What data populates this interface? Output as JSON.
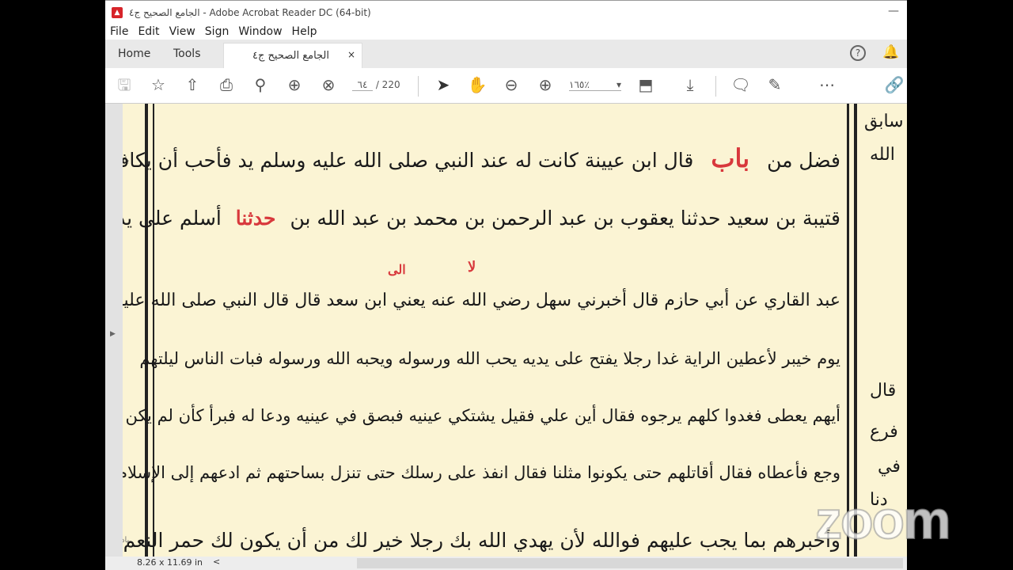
{
  "window": {
    "title": "الجامع الصحيح ج٤ - Adobe Acrobat Reader DC (64-bit)",
    "minimize": "—"
  },
  "menu": [
    "File",
    "Edit",
    "View",
    "Sign",
    "Window",
    "Help"
  ],
  "tabs": {
    "home": "Home",
    "tools": "Tools",
    "document": "الجامع الصحيح ج٤",
    "close": "×",
    "help": "?"
  },
  "toolbar": {
    "page_current": "٦٤",
    "page_total": "/ 220",
    "zoom": "١٦٥٪"
  },
  "status": {
    "page_size": "8.26 x 11.69 in",
    "scroll_left": "<"
  },
  "page": {
    "lines": [
      "قال ابن عيينة كانت له عند النبي صلى الله عليه وسلم يد فأحب أن يكافئه",
      "قتيبة بن سعيد حدثنا يعقوب بن عبد الرحمن بن محمد بن عبد الله بن",
      "عبد القاري عن أبي حازم قال أخبرني سهل رضي الله عنه يعني ابن سعد   قال قال النبي صلى الله عليه وسلم",
      "يوم خيبر لأعطين الراية غدا رجلا يفتح على يديه يحب الله ورسوله ويحبه الله ورسوله فبات الناس ليلتهم",
      "أيهم يعطى فغدوا كلهم يرجوه فقال أين علي فقيل يشتكي عينيه فبصق في عينيه ودعا له فبرأ كأن لم يكن به",
      "وجع فأعطاه فقال أقاتلهم حتى يكونوا مثلنا فقال انفذ على رسلك حتى تنزل بساحتهم ثم ادعهم إلى الإسلام",
      "وأخبرهم بما يجب عليهم فوالله لأن يهدي الله بك رجلا خير لك من أن يكون لك حمر النعم"
    ],
    "line1_tail": "فضل من",
    "line2_head": "أسلم على يديه رجل",
    "bab": "باب",
    "haddathana": "حدثنا",
    "annot_la": "لا",
    "annot_ila": "الى",
    "margin_label": "باد",
    "right_column": [
      "سابق",
      "الله",
      "قال",
      "فرع",
      "في",
      "دنا"
    ]
  },
  "watermark": "zoom"
}
